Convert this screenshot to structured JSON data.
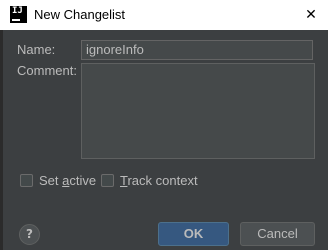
{
  "window": {
    "title": "New Changelist",
    "app_icon_text": "IJ",
    "close_glyph": "✕"
  },
  "form": {
    "name_label": "Name:",
    "name_value": "ignoreInfo",
    "comment_label": "Comment:",
    "comment_value": ""
  },
  "options": {
    "set_active": {
      "label_pre": "Set ",
      "label_mnemonic": "a",
      "label_post": "ctive",
      "checked": false
    },
    "track_context": {
      "label_pre": "",
      "label_mnemonic": "T",
      "label_post": "rack context",
      "checked": false
    }
  },
  "buttons": {
    "help_label": "?",
    "ok_label": "OK",
    "cancel_label": "Cancel"
  },
  "colors": {
    "background": "#3c3f41",
    "titlebar": "#ffffff",
    "field": "#45494a",
    "default_button": "#365880",
    "text": "#bbbbbb"
  }
}
